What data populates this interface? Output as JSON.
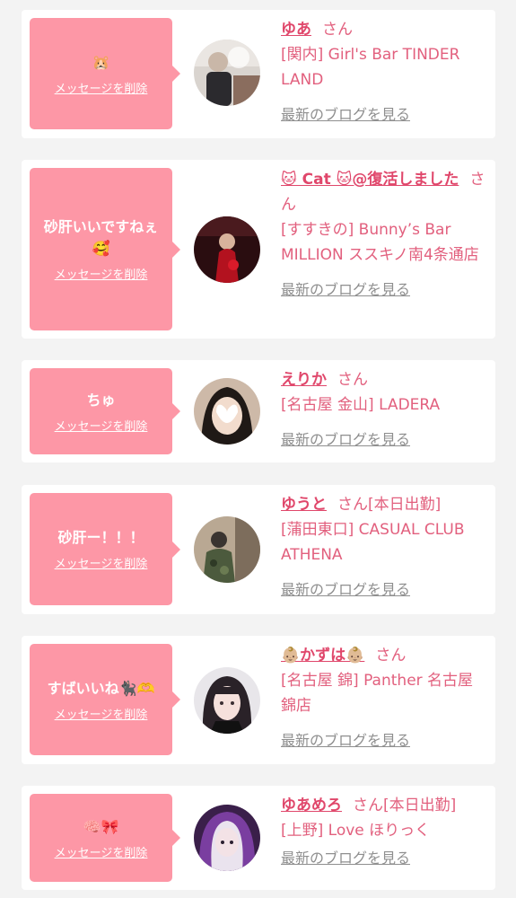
{
  "accent_color": "#fd97a6",
  "name_color": "#e0476b",
  "cards": [
    {
      "message": "🐹",
      "delete_label": "メッセージを削除",
      "name": "ゆあ",
      "honorific": "さん",
      "status": "",
      "shop": "[関内] Girl's Bar TINDER LAND",
      "blog_link": "最新のブログを見る",
      "avatar": "photo-girl-flowers"
    },
    {
      "message": "砂肝いいですねぇ🥰",
      "delete_label": "メッセージを削除",
      "name": "🐱 Cat 🐱@復活しました",
      "honorific": "さん",
      "status": "",
      "shop": "[すすきの] Bunny’s Bar MILLION ススキノ南4条通店",
      "blog_link": "最新のブログを見る",
      "avatar": "photo-red-dress"
    },
    {
      "message": "ちゅ",
      "delete_label": "メッセージを削除",
      "name": "えりか",
      "honorific": "さん",
      "status": "",
      "shop": "[名古屋 金山] LADERA",
      "blog_link": "最新のブログを見る",
      "avatar": "photo-heart-face"
    },
    {
      "message": "砂肝ー！！！",
      "delete_label": "メッセージを削除",
      "name": "ゆうと",
      "honorific": "さん",
      "status": "[本日出勤]",
      "shop": "[蒲田東口] CASUAL CLUB ATHENA",
      "blog_link": "最新のブログを見る",
      "avatar": "photo-camo-man"
    },
    {
      "message": "すばいいね🐈‍⬛🫶",
      "delete_label": "メッセージを削除",
      "name": "👶🏼かずは👶🏼",
      "honorific": "さん",
      "status": "",
      "shop": "[名古屋 錦] Panther 名古屋錦店",
      "blog_link": "最新のブログを見る",
      "avatar": "photo-idol-girl"
    },
    {
      "message": "🧠🎀",
      "delete_label": "メッセージを削除",
      "name": "ゆあめろ",
      "honorific": "さん",
      "status": "[本日出勤]",
      "shop": "[上野] Love ほりっく",
      "blog_link": "最新のブログを見る",
      "avatar": "photo-purple-hair"
    }
  ]
}
